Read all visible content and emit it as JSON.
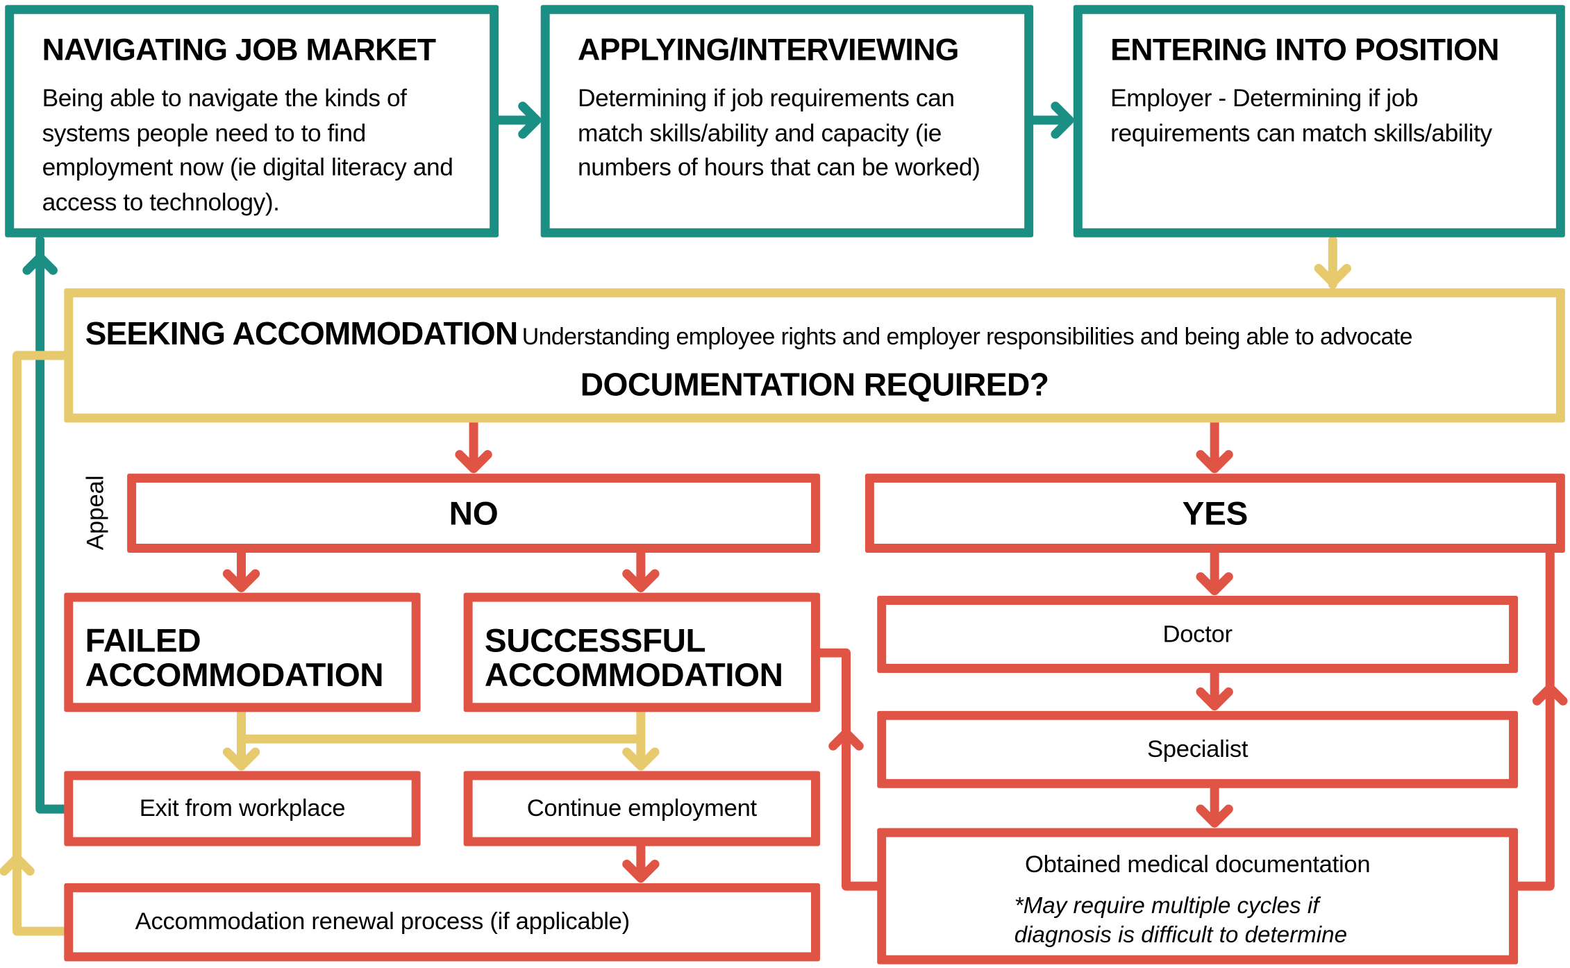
{
  "colors": {
    "teal": "#1b8f84",
    "yellow": "#e8ca6e",
    "red": "#e05446"
  },
  "stages": [
    {
      "title": "NAVIGATING JOB MARKET",
      "body": "Being able to navigate the kinds of systems people need to to find employment now (ie digital literacy and access to technology)."
    },
    {
      "title": "APPLYING/INTERVIEWING",
      "body": "Determining if job requirements can match skills/ability and capacity (ie numbers of hours that can be worked)"
    },
    {
      "title": "ENTERING INTO POSITION",
      "body": "Employer - Determining if job requirements can match skills/ability"
    }
  ],
  "seeking": {
    "title": "SEEKING ACCOMMODATION",
    "subtitle": "Understanding employee rights and employer responsibilities and being able to advocate",
    "question": "DOCUMENTATION REQUIRED?"
  },
  "appeal": "Appeal",
  "no": {
    "label": "NO",
    "failed": "FAILED ACCOMMODATION",
    "successful": "SUCCESSFUL ACCOMMODATION",
    "exit": "Exit from workplace",
    "continue": "Continue employment",
    "renewal": "Accommodation renewal process (if applicable)"
  },
  "yes": {
    "label": "YES",
    "doctor": "Doctor",
    "specialist": "Specialist",
    "obtained": "Obtained medical documentation",
    "note": "*May require multiple cycles if diagnosis is difficult to determine"
  }
}
